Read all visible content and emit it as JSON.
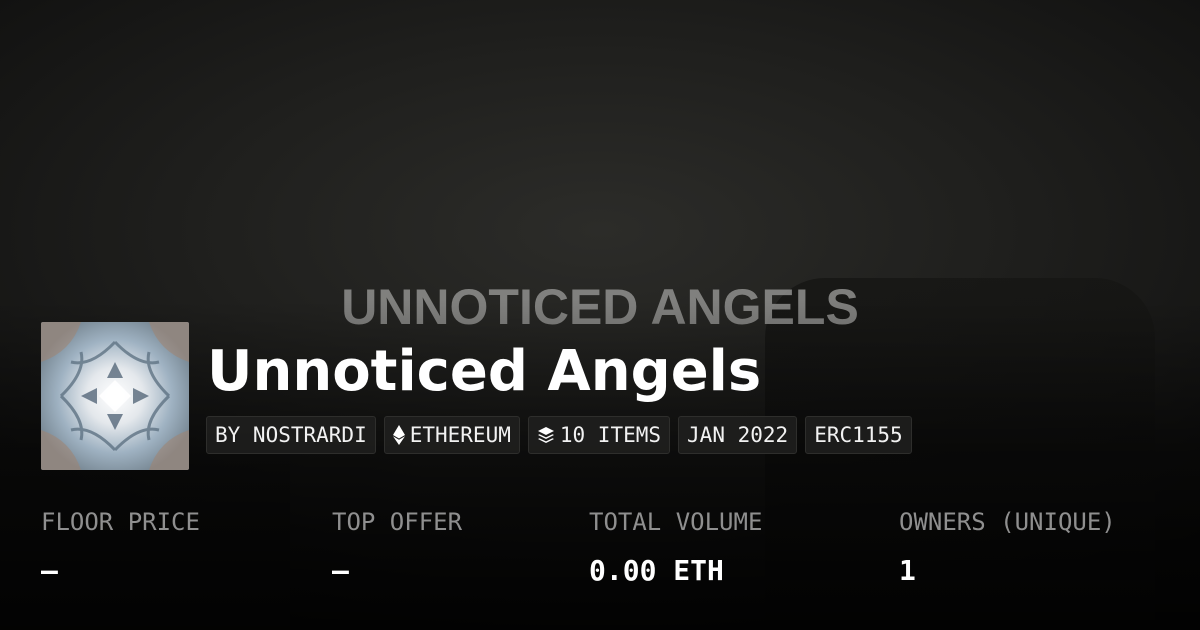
{
  "banner": {
    "text": "UNNOTICED ANGELS"
  },
  "collection": {
    "title": "Unnoticed Angels",
    "thumbnail_icon": "kaleidoscope-artwork"
  },
  "tags": {
    "creator": "BY NOSTRARDI",
    "chain": "ETHEREUM",
    "chain_icon": "ethereum-icon",
    "items": "10 ITEMS",
    "items_icon": "layers-icon",
    "date": "JAN 2022",
    "standard": "ERC1155"
  },
  "stats": [
    {
      "label": "FLOOR PRICE",
      "value": "–"
    },
    {
      "label": "TOP OFFER",
      "value": "–"
    },
    {
      "label": "TOTAL VOLUME",
      "value": "0.00 ETH"
    },
    {
      "label": "OWNERS (UNIQUE)",
      "value": "1"
    }
  ],
  "colors": {
    "background": "#1f1f1d",
    "text_primary": "#ffffff",
    "text_muted": "#8f8f8f",
    "tag_background": "#1e1e1d"
  }
}
